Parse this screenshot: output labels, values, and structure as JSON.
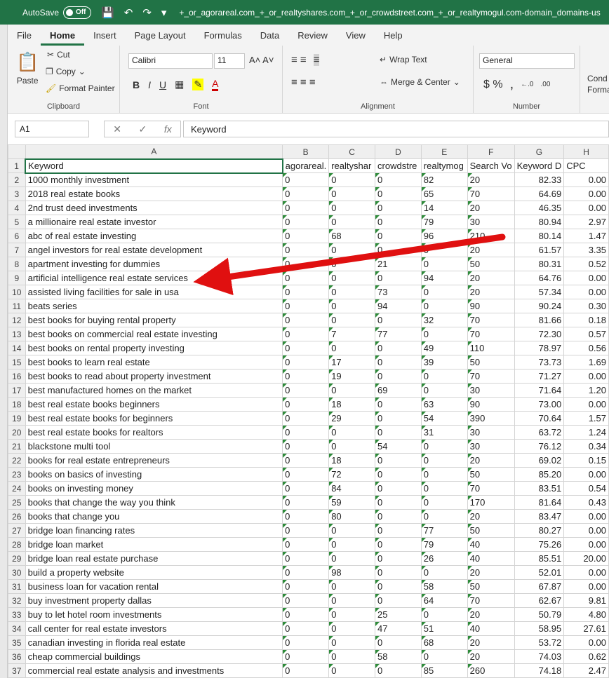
{
  "titlebar": {
    "autosave": "AutoSave",
    "toggle_state": "Off",
    "filename": "+_or_agorareal.com_+_or_realtyshares.com_+_or_crowdstreet.com_+_or_realtymogul.com-domain_domains-us"
  },
  "menu": [
    "File",
    "Home",
    "Insert",
    "Page Layout",
    "Formulas",
    "Data",
    "Review",
    "View",
    "Help"
  ],
  "ribbon": {
    "clipboard": {
      "label": "Clipboard",
      "paste": "Paste",
      "cut": "Cut",
      "copy": "Copy",
      "format_painter": "Format Painter"
    },
    "font": {
      "label": "Font",
      "name": "Calibri",
      "size": "11"
    },
    "alignment": {
      "label": "Alignment",
      "wrap": "Wrap Text",
      "merge": "Merge & Center"
    },
    "number": {
      "label": "Number",
      "format": "General"
    },
    "styles": {
      "cond": "Cond",
      "forma": "Forma"
    }
  },
  "formula": {
    "namebox": "A1",
    "content": "Keyword"
  },
  "columns": [
    "A",
    "B",
    "C",
    "D",
    "E",
    "F",
    "G",
    "H"
  ],
  "headers": [
    "Keyword",
    "agorareal.",
    "realtyshar",
    "crowdstre",
    "realtymog",
    "Search Vo",
    "Keyword D",
    "CPC"
  ],
  "rows": [
    [
      "1000 monthly investment",
      "0",
      "0",
      "0",
      "82",
      "20",
      "82.33",
      "0.00"
    ],
    [
      "2018 real estate books",
      "0",
      "0",
      "0",
      "65",
      "70",
      "64.69",
      "0.00"
    ],
    [
      "2nd trust deed investments",
      "0",
      "0",
      "0",
      "14",
      "20",
      "46.35",
      "0.00"
    ],
    [
      "a millionaire real estate investor",
      "0",
      "0",
      "0",
      "79",
      "30",
      "80.94",
      "2.97"
    ],
    [
      "abc of real estate investing",
      "0",
      "68",
      "0",
      "96",
      "210",
      "80.14",
      "1.47"
    ],
    [
      "angel investors for real estate development",
      "0",
      "0",
      "0",
      "0",
      "20",
      "61.57",
      "3.35"
    ],
    [
      "apartment investing for dummies",
      "0",
      "0",
      "21",
      "0",
      "50",
      "80.31",
      "0.52"
    ],
    [
      "artificial intelligence real estate services",
      "0",
      "0",
      "0",
      "94",
      "20",
      "64.76",
      "0.00"
    ],
    [
      "assisted living facilities for sale in usa",
      "0",
      "0",
      "73",
      "0",
      "20",
      "57.34",
      "0.00"
    ],
    [
      "beats series",
      "0",
      "0",
      "94",
      "0",
      "90",
      "90.24",
      "0.30"
    ],
    [
      "best books for buying rental property",
      "0",
      "0",
      "0",
      "32",
      "70",
      "81.66",
      "0.18"
    ],
    [
      "best books on commercial real estate investing",
      "0",
      "7",
      "77",
      "0",
      "70",
      "72.30",
      "0.57"
    ],
    [
      "best books on rental property investing",
      "0",
      "0",
      "0",
      "49",
      "110",
      "78.97",
      "0.56"
    ],
    [
      "best books to learn real estate",
      "0",
      "17",
      "0",
      "39",
      "50",
      "73.73",
      "1.69"
    ],
    [
      "best books to read about property investment",
      "0",
      "19",
      "0",
      "0",
      "70",
      "71.27",
      "0.00"
    ],
    [
      "best manufactured homes on the market",
      "0",
      "0",
      "69",
      "0",
      "30",
      "71.64",
      "1.20"
    ],
    [
      "best real estate books beginners",
      "0",
      "18",
      "0",
      "63",
      "90",
      "73.00",
      "0.00"
    ],
    [
      "best real estate books for beginners",
      "0",
      "29",
      "0",
      "54",
      "390",
      "70.64",
      "1.57"
    ],
    [
      "best real estate books for realtors",
      "0",
      "0",
      "0",
      "31",
      "30",
      "63.72",
      "1.24"
    ],
    [
      "blackstone multi tool",
      "0",
      "0",
      "54",
      "0",
      "30",
      "76.12",
      "0.34"
    ],
    [
      "books for real estate entrepreneurs",
      "0",
      "18",
      "0",
      "0",
      "20",
      "69.02",
      "0.15"
    ],
    [
      "books on basics of investing",
      "0",
      "72",
      "0",
      "0",
      "50",
      "85.20",
      "0.00"
    ],
    [
      "books on investing money",
      "0",
      "84",
      "0",
      "0",
      "70",
      "83.51",
      "0.54"
    ],
    [
      "books that change the way you think",
      "0",
      "59",
      "0",
      "0",
      "170",
      "81.64",
      "0.43"
    ],
    [
      "books that change you",
      "0",
      "80",
      "0",
      "0",
      "20",
      "83.47",
      "0.00"
    ],
    [
      "bridge loan financing rates",
      "0",
      "0",
      "0",
      "77",
      "50",
      "80.27",
      "0.00"
    ],
    [
      "bridge loan market",
      "0",
      "0",
      "0",
      "79",
      "40",
      "75.26",
      "0.00"
    ],
    [
      "bridge loan real estate purchase",
      "0",
      "0",
      "0",
      "26",
      "40",
      "85.51",
      "20.00"
    ],
    [
      "build a property website",
      "0",
      "98",
      "0",
      "0",
      "20",
      "52.01",
      "0.00"
    ],
    [
      "business loan for vacation rental",
      "0",
      "0",
      "0",
      "58",
      "50",
      "67.87",
      "0.00"
    ],
    [
      "buy investment property dallas",
      "0",
      "0",
      "0",
      "64",
      "70",
      "62.67",
      "9.81"
    ],
    [
      "buy to let hotel room investments",
      "0",
      "0",
      "25",
      "0",
      "20",
      "50.79",
      "4.80"
    ],
    [
      "call center for real estate investors",
      "0",
      "0",
      "47",
      "51",
      "40",
      "58.95",
      "27.61"
    ],
    [
      "canadian investing in florida real estate",
      "0",
      "0",
      "0",
      "68",
      "20",
      "53.72",
      "0.00"
    ],
    [
      "cheap commercial buildings",
      "0",
      "0",
      "58",
      "0",
      "20",
      "74.03",
      "0.62"
    ],
    [
      "commercial real estate analysis and investments",
      "0",
      "0",
      "0",
      "85",
      "260",
      "74.18",
      "2.47"
    ]
  ]
}
